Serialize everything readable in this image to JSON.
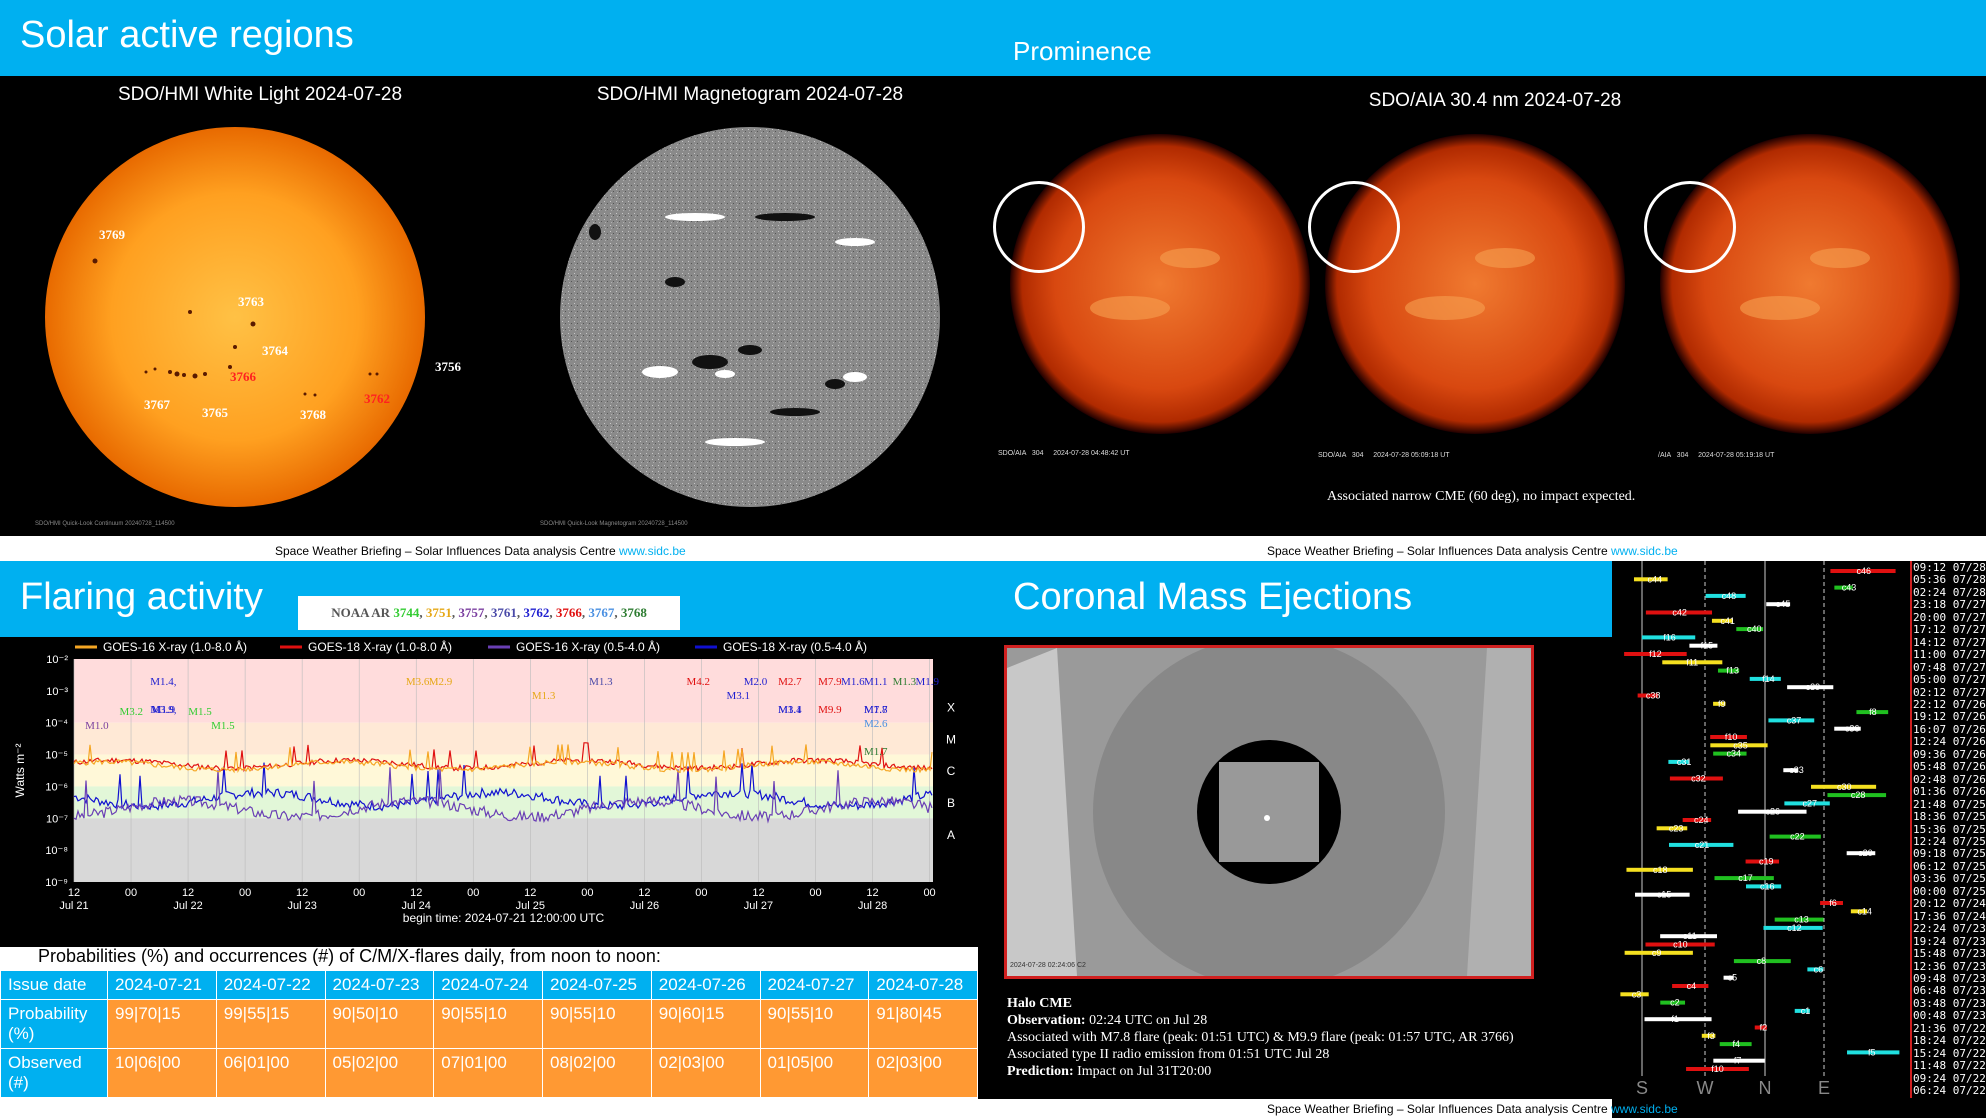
{
  "panels": {
    "active_regions": {
      "title": "Solar active regions",
      "white_light_caption": "SDO/HMI White Light 2024-07-28",
      "magnetogram_caption": "SDO/HMI Magnetogram 2024-07-28",
      "white_light_stamp": "SDO/HMI  Quick-Look  Continuum  20240728_114500",
      "magnetogram_stamp": "SDO/HMI  Quick-Look  Magnetogram  20240728_114500",
      "labels": [
        {
          "text": "3769",
          "red": false
        },
        {
          "text": "3763",
          "red": false
        },
        {
          "text": "3764",
          "red": false
        },
        {
          "text": "3766",
          "red": true
        },
        {
          "text": "3756",
          "red": false
        },
        {
          "text": "3762",
          "red": true
        },
        {
          "text": "3767",
          "red": false
        },
        {
          "text": "3765",
          "red": false
        },
        {
          "text": "3768",
          "red": false
        }
      ]
    },
    "prominence": {
      "title": "Prominence",
      "caption": "SDO/AIA 30.4 nm 2024-07-28",
      "stamps": [
        "SDO/AIA   304     2024-07-28 04:48:42 UT",
        "SDO/AIA   304     2024-07-28 05:09:18 UT",
        "/AIA   304     2024-07-28 05:19:18 UT"
      ],
      "note": "Associated narrow CME (60 deg), no impact expected."
    },
    "flaring": {
      "title": "Flaring activity",
      "noaa_prefix": "NOAA AR",
      "noaa_regions": [
        {
          "text": "3744",
          "color": "#33cc33"
        },
        {
          "text": "3751",
          "color": "#e6a817"
        },
        {
          "text": "3757",
          "color": "#7b3fa0"
        },
        {
          "text": "3761",
          "color": "#4a4aa8"
        },
        {
          "text": "3762",
          "color": "#1f1fd0"
        },
        {
          "text": "3766",
          "color": "#e01010"
        },
        {
          "text": "3767",
          "color": "#4a90e2"
        },
        {
          "text": "3768",
          "color": "#2e7d32"
        }
      ],
      "chart_data": {
        "type": "line",
        "legend": [
          {
            "name": "GOES-16 X-ray (1.0-8.0 Å)",
            "color": "#f5a623"
          },
          {
            "name": "GOES-18 X-ray (1.0-8.0 Å)",
            "color": "#e01010"
          },
          {
            "name": "GOES-16 X-ray (0.5-4.0 Å)",
            "color": "#6a3fb5"
          },
          {
            "name": "GOES-18 X-ray (0.5-4.0 Å)",
            "color": "#1010d0"
          }
        ],
        "ylabel": "Watts m⁻²",
        "xlabel": "begin time: 2024-07-21 12:00:00 UTC",
        "yscale": "log",
        "ylim": [
          1e-09,
          0.01
        ],
        "y_ticks": [
          "10⁻²",
          "10⁻³",
          "10⁻⁴",
          "10⁻⁵",
          "10⁻⁶",
          "10⁻⁷",
          "10⁻⁸",
          "10⁻⁹"
        ],
        "x_ticks": [
          {
            "top": "12",
            "bottom": "Jul 21"
          },
          {
            "top": "00",
            "bottom": ""
          },
          {
            "top": "12",
            "bottom": "Jul 22"
          },
          {
            "top": "00",
            "bottom": ""
          },
          {
            "top": "12",
            "bottom": "Jul 23"
          },
          {
            "top": "00",
            "bottom": ""
          },
          {
            "top": "12",
            "bottom": "Jul 24"
          },
          {
            "top": "00",
            "bottom": ""
          },
          {
            "top": "12",
            "bottom": "Jul 25"
          },
          {
            "top": "00",
            "bottom": ""
          },
          {
            "top": "12",
            "bottom": "Jul 26"
          },
          {
            "top": "00",
            "bottom": ""
          },
          {
            "top": "12",
            "bottom": "Jul 27"
          },
          {
            "top": "00",
            "bottom": ""
          },
          {
            "top": "12",
            "bottom": "Jul 28"
          },
          {
            "top": "00",
            "bottom": ""
          }
        ],
        "class_labels": [
          "X",
          "M",
          "C",
          "B",
          "A"
        ],
        "flare_labels": [
          {
            "text": "M1.0",
            "day": 0.2,
            "color": "#7b3fa0"
          },
          {
            "text": "M3.2",
            "day": 0.5,
            "color": "#33cc33"
          },
          {
            "text": "M1.4,",
            "day": 0.78,
            "color": "#1f1fd0"
          },
          {
            "text": "M3.9,",
            "day": 0.78,
            "color": "#1f1fd0"
          },
          {
            "text": "M1.9",
            "day": 0.78,
            "color": "#1f1fd0"
          },
          {
            "text": "M1.5",
            "day": 1.1,
            "color": "#33cc33"
          },
          {
            "text": "M1.5",
            "day": 1.3,
            "color": "#33cc33"
          },
          {
            "text": "M3.6",
            "day": 3.0,
            "color": "#e6a817"
          },
          {
            "text": "M2.9",
            "day": 3.2,
            "color": "#e6a817"
          },
          {
            "text": "M1.3",
            "day": 4.1,
            "color": "#e6a817"
          },
          {
            "text": "M1.3",
            "day": 4.6,
            "color": "#4a4aa8"
          },
          {
            "text": "M4.2",
            "day": 5.45,
            "color": "#e01010"
          },
          {
            "text": "M3.1",
            "day": 5.8,
            "color": "#1f1fd0"
          },
          {
            "text": "M2.0",
            "day": 5.95,
            "color": "#1f1fd0"
          },
          {
            "text": "M2.7",
            "day": 6.25,
            "color": "#e01010"
          },
          {
            "text": "M3.4",
            "day": 6.25,
            "color": "#1f1fd0"
          },
          {
            "text": "M1.1",
            "day": 6.25,
            "color": "#1f1fd0"
          },
          {
            "text": "M7.9",
            "day": 6.6,
            "color": "#e01010"
          },
          {
            "text": "M9.9",
            "day": 6.6,
            "color": "#e01010"
          },
          {
            "text": "M1.6",
            "day": 6.8,
            "color": "#1f1fd0"
          },
          {
            "text": "M1.1",
            "day": 7.0,
            "color": "#1f1fd0"
          },
          {
            "text": "M7.8",
            "day": 7.0,
            "color": "#1f1fd0"
          },
          {
            "text": "M1.7",
            "day": 7.0,
            "color": "#1f1fd0"
          },
          {
            "text": "M2.6",
            "day": 7.0,
            "color": "#4a90e2"
          },
          {
            "text": "M1.7",
            "day": 7.0,
            "color": "#2e7d32"
          },
          {
            "text": "M1.3",
            "day": 7.25,
            "color": "#2e7d32"
          },
          {
            "text": "M1.9",
            "day": 7.45,
            "color": "#1f1fd0"
          }
        ]
      },
      "prob_title": "Probabilities (%) and occurrences (#) of C/M/X-flares daily, from noon to noon:",
      "table": {
        "header": [
          "Issue date",
          "2024-07-21",
          "2024-07-22",
          "2024-07-23",
          "2024-07-24",
          "2024-07-25",
          "2024-07-26",
          "2024-07-27",
          "2024-07-28"
        ],
        "probability": [
          "Probability (%)",
          "99|70|15",
          "99|55|15",
          "90|50|10",
          "90|55|10",
          "90|55|10",
          "90|60|15",
          "90|55|10",
          "91|80|45"
        ],
        "observed": [
          "Observed (#)",
          "10|06|00",
          "06|01|00",
          "05|02|00",
          "07|01|00",
          "08|02|00",
          "02|03|00",
          "01|05|00",
          "02|03|00"
        ]
      }
    },
    "cme": {
      "title": "Coronal Mass Ejections",
      "image_stamp": "2024-07-28 02:24:06 C2",
      "halo": "Halo CME",
      "observation_label": "Observation:",
      "observation": "02:24 UTC on Jul 28",
      "assoc1": "Associated with M7.8 flare (peak: 01:51 UTC) & M9.9 flare (peak: 01:57 UTC, AR 3766)",
      "assoc2": "Associated type II radio emission from 01:51 UTC Jul 28",
      "prediction_label": "Prediction:",
      "prediction": "Impact on Jul 31T20:00",
      "cactus_directions": [
        "S",
        "W",
        "N",
        "E"
      ],
      "cactus_labels": [
        "c46",
        "c44",
        "c43",
        "c48",
        "c45",
        "c42",
        "c41",
        "c40",
        "f16",
        "f15",
        "f12",
        "f11",
        "f13",
        "f14",
        "c39",
        "c38",
        "f9",
        "f8",
        "c37",
        "c36",
        "f10",
        "c35",
        "c34",
        "c31",
        "c33",
        "c32",
        "c30",
        "c28",
        "c27",
        "c26",
        "c24",
        "c23",
        "c22",
        "c21",
        "c20",
        "c19",
        "c18",
        "c17",
        "c16",
        "c15",
        "f6",
        "c14",
        "c13",
        "c12",
        "c11",
        "c10",
        "c9",
        "c8",
        "c6",
        "c5",
        "c4",
        "c3",
        "c2",
        "c1",
        "f1",
        "f2",
        "f3",
        "f4",
        "f5",
        "f7",
        "f10"
      ],
      "timestamps": [
        "09:12 07/28",
        "05:36 07/28",
        "02:24 07/28",
        "23:18 07/27",
        "20:00 07/27",
        "17:12 07/27",
        "14:12 07/27",
        "11:00 07/27",
        "07:48 07/27",
        "05:00 07/27",
        "02:12 07/27",
        "22:12 07/26",
        "19:12 07/26",
        "16:07 07/26",
        "12:24 07/26",
        "09:36 07/26",
        "05:48 07/26",
        "02:48 07/26",
        "01:36 07/26",
        "21:48 07/25",
        "18:36 07/25",
        "15:36 07/25",
        "12:24 07/25",
        "09:18 07/25",
        "06:12 07/25",
        "03:36 07/25",
        "00:00 07/25",
        "20:12 07/24",
        "17:36 07/24",
        "22:24 07/23",
        "19:24 07/23",
        "15:48 07/23",
        "12:36 07/23",
        "09:48 07/23",
        "06:48 07/23",
        "03:48 07/23",
        "00:48 07/23",
        "21:36 07/22",
        "18:24 07/22",
        "15:24 07/22",
        "11:48 07/22",
        "09:24 07/22",
        "06:24 07/22"
      ]
    }
  },
  "footers": [
    {
      "text": "Space Weather Briefing – Solar Influences Data analysis Centre ",
      "link": "www.sidc.be"
    },
    {
      "text": "Space Weather Briefing – Solar Influences Data analysis Centre ",
      "link": "www.sidc.be"
    },
    {
      "text": "Space Weather Briefing – Solar Influences Data analysis Centre ",
      "link": "www.sidc.be"
    }
  ]
}
